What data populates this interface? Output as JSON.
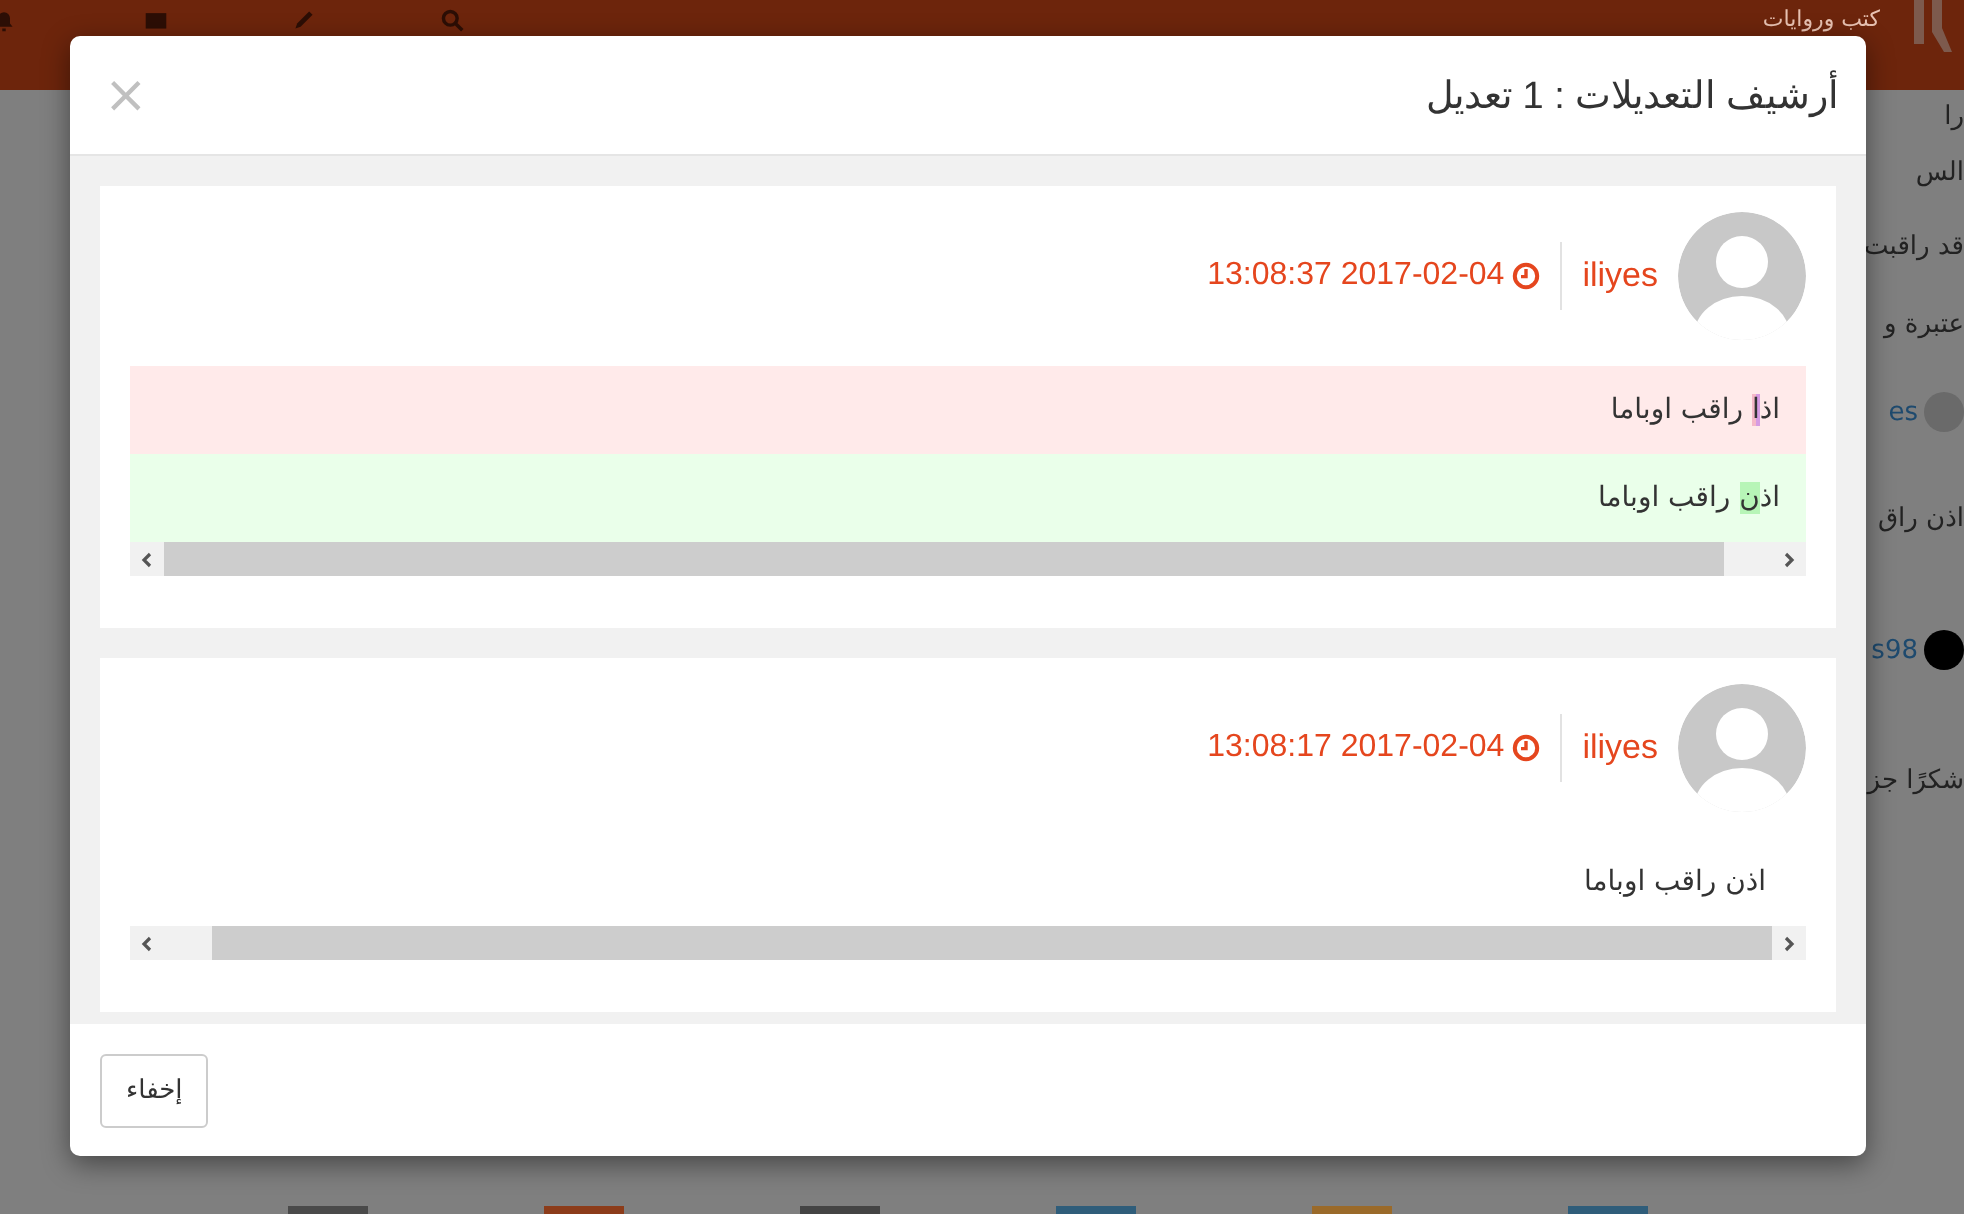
{
  "topbar": {
    "title": "كتب وروايات"
  },
  "side_items": [
    {
      "kind": "text",
      "text": "را"
    },
    {
      "kind": "text",
      "text": "الس"
    },
    {
      "kind": "text",
      "text": "قد راقبت"
    },
    {
      "kind": "text",
      "text": "عتبرة و"
    },
    {
      "kind": "user",
      "text": "es"
    },
    {
      "kind": "text",
      "text": "اذن راق"
    },
    {
      "kind": "user",
      "text": "s98"
    },
    {
      "kind": "text",
      "text": "شكرًا جز"
    }
  ],
  "modal": {
    "title": "أرشيف التعديلات : 1 تعديل",
    "close": "×",
    "revisions": [
      {
        "user": "iliyes",
        "time": "13:08:37 2017-02-04",
        "lines": [
          {
            "kind": "removed",
            "segments": [
              {
                "text": "اذ",
                "changed": false
              },
              {
                "text": "ا",
                "changed": true
              },
              {
                "text": " راقب اوباما",
                "changed": false
              }
            ]
          },
          {
            "kind": "added",
            "segments": [
              {
                "text": "اذ",
                "changed": false
              },
              {
                "text": "ن",
                "changed": true
              },
              {
                "text": " راقب اوباما",
                "changed": false
              }
            ]
          }
        ]
      },
      {
        "user": "iliyes",
        "time": "13:08:17 2017-02-04",
        "lines": [
          {
            "kind": "plain",
            "segments": [
              {
                "text": "اذن راقب اوباما",
                "changed": false
              }
            ]
          }
        ]
      }
    ],
    "footer_button": "إخفاء"
  }
}
